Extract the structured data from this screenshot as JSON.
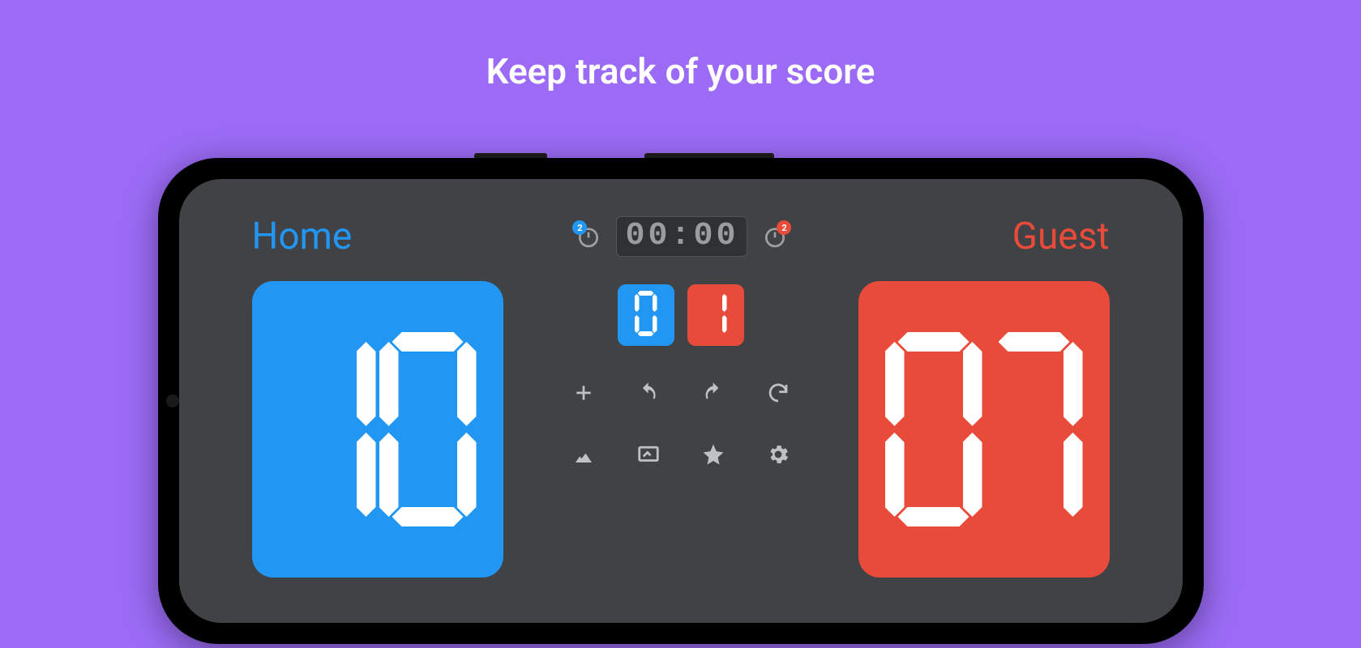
{
  "headline": "Keep track of your score",
  "teams": {
    "home": {
      "label": "Home",
      "score": "10",
      "color": "#2196f3"
    },
    "guest": {
      "label": "Guest",
      "score": "07",
      "color": "#e94b3a"
    }
  },
  "timer": {
    "value": "00:00"
  },
  "shot_clocks": {
    "home_badge": "2",
    "guest_badge": "2"
  },
  "period": {
    "home": "0",
    "guest": "1"
  },
  "controls": {
    "add": "plus-icon",
    "undo": "undo-icon",
    "redo": "redo-icon",
    "reset": "refresh-icon",
    "image": "image-icon",
    "display": "display-icon",
    "star": "star-icon",
    "settings": "gear-icon"
  },
  "colors": {
    "bg": "#9b6bf5",
    "screen": "#404245",
    "blue": "#2196f3",
    "red": "#e94b3a",
    "icon": "#bfc1c3"
  }
}
